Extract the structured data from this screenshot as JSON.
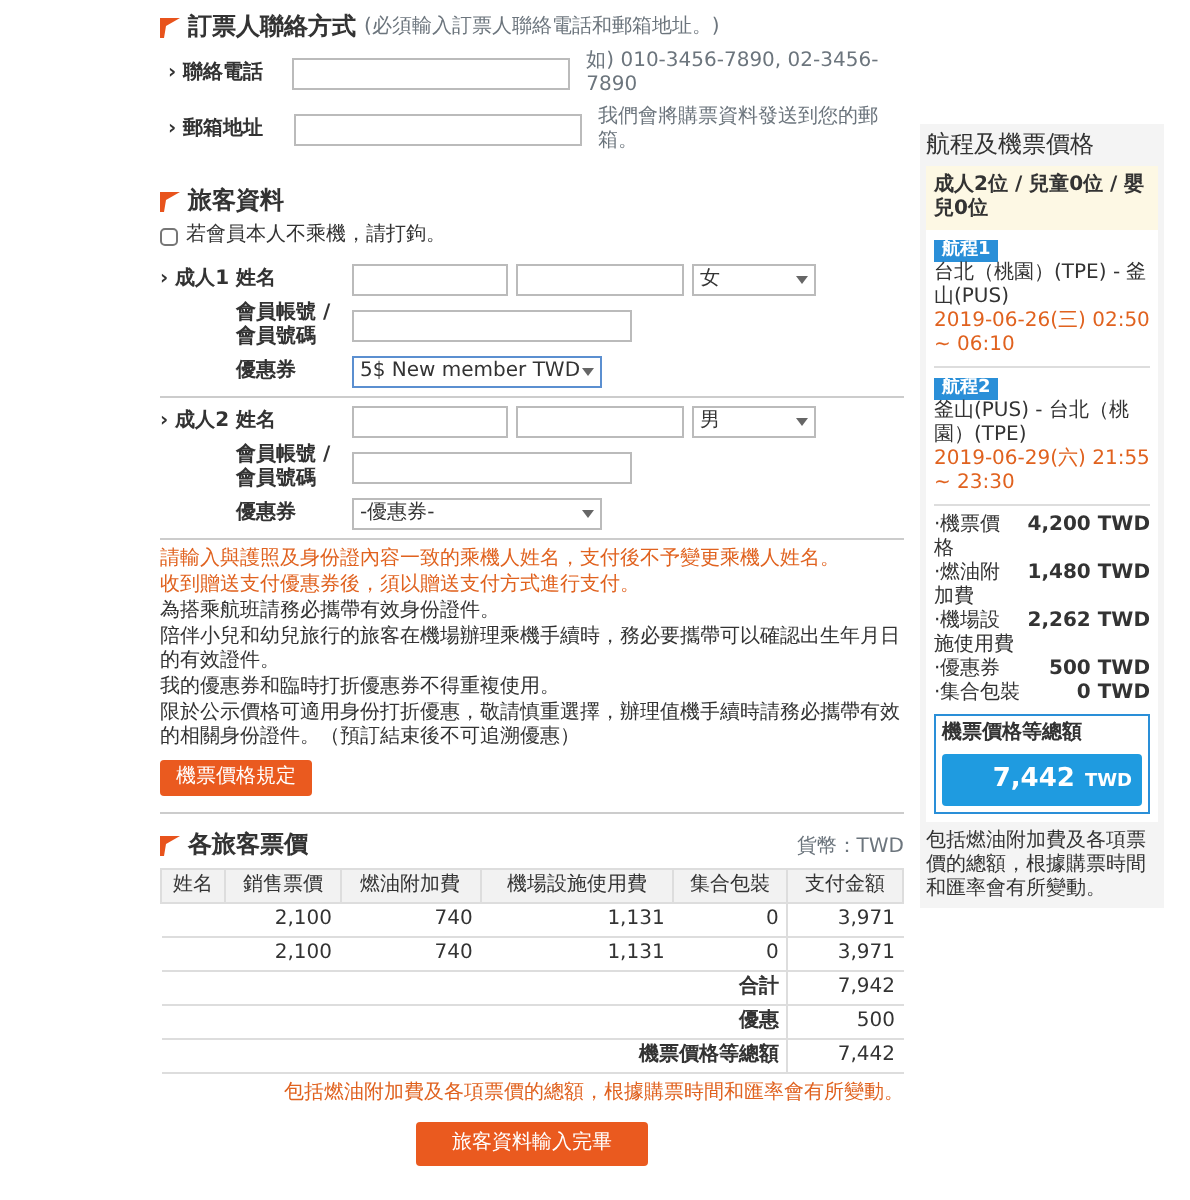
{
  "contact": {
    "title": "訂票人聯絡方式",
    "hint": "(必須輸入訂票人聯絡電話和郵箱地址。)",
    "fields": [
      {
        "label": "› 聯絡電話",
        "note": "如) 010-3456-7890, 02-3456-7890"
      },
      {
        "label": "› 郵箱地址",
        "note": "我們會將購票資料發送到您的郵箱。"
      }
    ]
  },
  "passengers": {
    "title": "旅客資料",
    "checkbox": {
      "label": "若會員本人不乘機，請打鉤。",
      "checked": false
    },
    "items": [
      {
        "label": "› 成人1",
        "name_label": "姓名",
        "member_label": "會員帳號 / 會員號碼",
        "coupon_label": "優惠券",
        "gender": "女",
        "coupon": "5$ New member TWD",
        "coupon_focused": true
      },
      {
        "label": "› 成人2",
        "name_label": "姓名",
        "member_label": "會員帳號 / 會員號碼",
        "coupon_label": "優惠券",
        "gender": "男",
        "coupon": "-優惠券-",
        "coupon_focused": false
      }
    ],
    "notes": [
      {
        "text": "請輸入與護照及身份證內容一致的乘機人姓名，支付後不予變更乘機人姓名。",
        "emphasis": true
      },
      {
        "text": "收到贈送支付優惠券後，須以贈送支付方式進行支付。",
        "emphasis": true
      },
      {
        "text": "為搭乘航班請務必攜帶有效身份證件。",
        "emphasis": false
      },
      {
        "text": "陪伴小兒和幼兒旅行的旅客在機場辦理乘機手續時，務必要攜帶可以確認出生年月日的有效證件。",
        "emphasis": false
      },
      {
        "text": "我的優惠券和臨時打折優惠券不得重複使用。",
        "emphasis": false
      },
      {
        "text": "限於公示價格可適用身份打折優惠，敬請慎重選擇，辦理值機手續時請務必攜帶有效的相關身份證件。（預訂結束後不可追溯優惠）",
        "emphasis": false
      }
    ],
    "rules_button": "機票價格規定"
  },
  "fares": {
    "title": "各旅客票價",
    "currency": "貨幣：TWD",
    "columns": [
      "姓名",
      "銷售票價",
      "燃油附加費",
      "機場設施使用費",
      "集合包裝",
      "支付金額"
    ],
    "rows": [
      [
        "",
        "2,100",
        "740",
        "1,131",
        "0",
        "3,971"
      ],
      [
        "",
        "2,100",
        "740",
        "1,131",
        "0",
        "3,971"
      ]
    ],
    "summary": [
      {
        "label": "合計",
        "value": "7,942"
      },
      {
        "label": "優惠",
        "value": "500"
      },
      {
        "label": "機票價格等總額",
        "value": "7,442"
      }
    ],
    "note": "包括燃油附加費及各項票價的總額，根據購票時間和匯率會有所變動。",
    "submit": "旅客資料輸入完畢"
  },
  "sidebar": {
    "title": "航程及機票價格",
    "travellers": "成人2位 / 兒童0位 / 嬰兒0位",
    "segments": [
      {
        "badge": "航程1",
        "route": "台北（桃園）(TPE) - 釜山(PUS)",
        "time": "2019-06-26(三) 02:50 ~ 06:10"
      },
      {
        "badge": "航程2",
        "route": "釜山(PUS) - 台北（桃園）(TPE)",
        "time": "2019-06-29(六) 21:55 ~ 23:30"
      }
    ],
    "prices": [
      {
        "label": "·機票價格",
        "value": "4,200 TWD"
      },
      {
        "label": "·燃油附加費",
        "value": "1,480 TWD"
      },
      {
        "label": "·機場設施使用費",
        "value": "2,262 TWD"
      },
      {
        "label": "·優惠券",
        "value": "500 TWD"
      },
      {
        "label": "·集合包裝",
        "value": "0 TWD"
      }
    ],
    "total_label": "機票價格等總額",
    "total": "7,442",
    "total_currency": "TWD",
    "note": "包括燃油附加費及各項票價的總額，根據購票時間和匯率會有所變動。"
  }
}
